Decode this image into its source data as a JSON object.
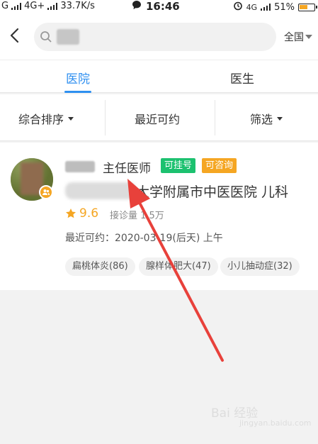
{
  "status_bar": {
    "carrier1": "G",
    "carrier2": "4G+",
    "speed": "33.7K/s",
    "time": "16:46",
    "network": "4G",
    "battery": "51%"
  },
  "search": {
    "placeholder": ""
  },
  "region": {
    "label": "全国"
  },
  "tabs": [
    {
      "label": "医院"
    },
    {
      "label": "医生"
    }
  ],
  "filters": {
    "sort": "综合排序",
    "recent": "最近可约",
    "filter": "筛选"
  },
  "doctor": {
    "title": "主任医师",
    "tag_register": "可挂号",
    "tag_consult": "可咨询",
    "hospital": "大学附属市中医医院 儿科",
    "score": "9.6",
    "consults": "接诊量 1.5万",
    "recent_available": "最近可约：2020-03-19(后天) 上午",
    "specialties": [
      "扁桃体炎(86)",
      "腺样体肥大(47)",
      "小儿抽动症(32)"
    ]
  },
  "colors": {
    "accent": "#2e8ff0",
    "register_tag": "#1cc16f",
    "consult_tag": "#f5a623",
    "annotation_arrow": "#e8413b"
  },
  "watermark": {
    "text": "Bai 经验",
    "sub": "jingyan.baidu.com"
  }
}
